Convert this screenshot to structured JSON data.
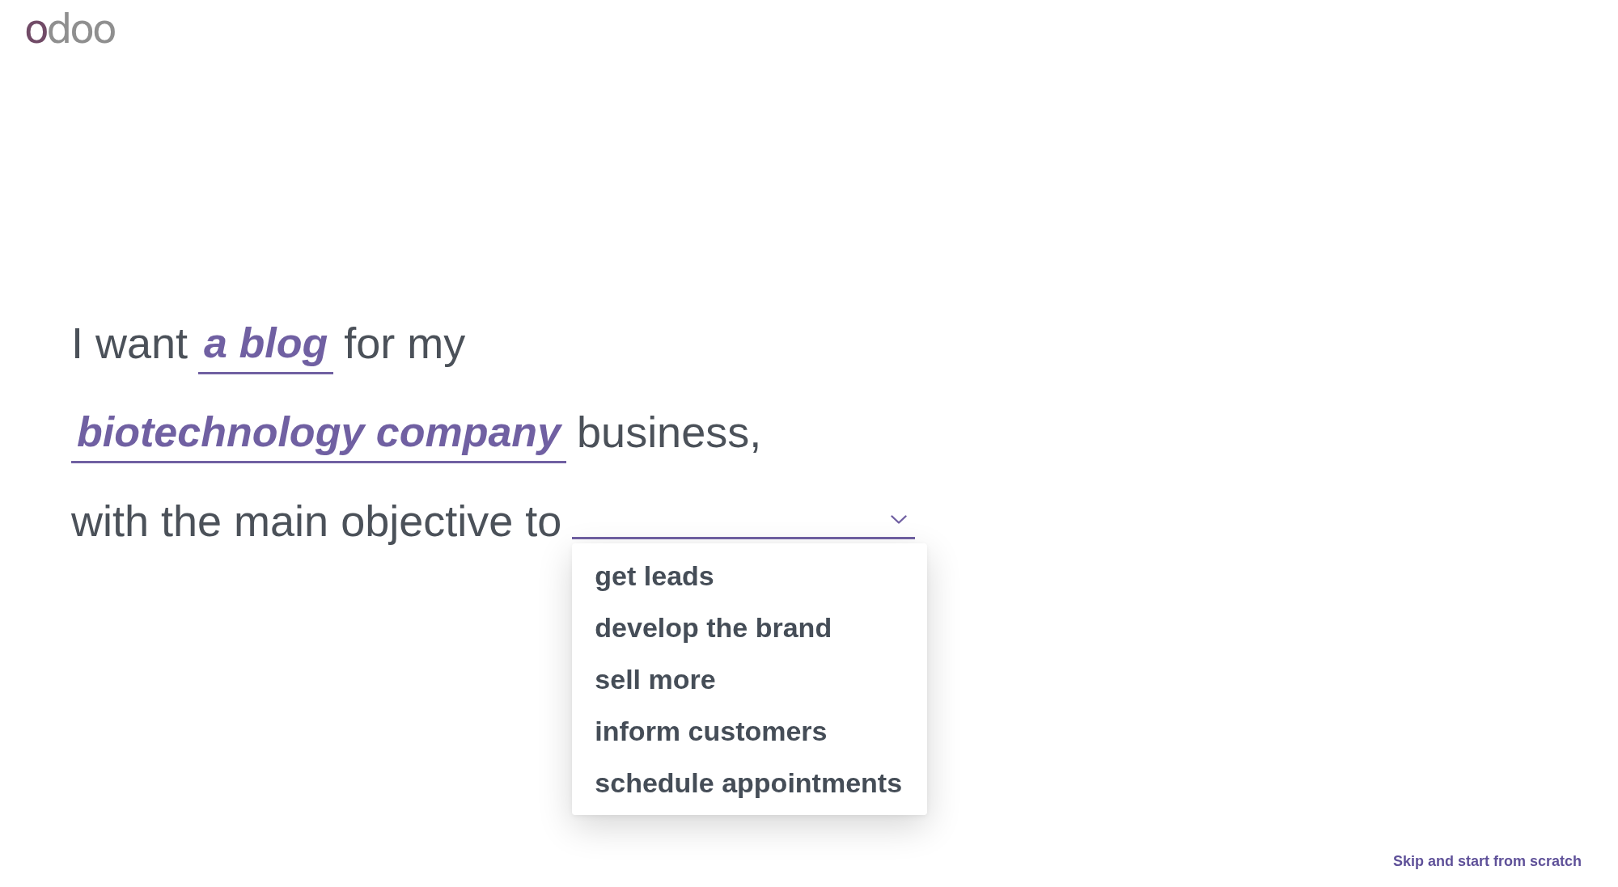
{
  "logo": {
    "text": "odoo"
  },
  "sentence": {
    "lines": [
      {
        "parts": [
          {
            "kind": "text",
            "text": "I want"
          },
          {
            "kind": "field",
            "value": "a blog"
          },
          {
            "kind": "text",
            "text": "for my"
          }
        ]
      },
      {
        "parts": [
          {
            "kind": "field",
            "value": "biotechnology company"
          },
          {
            "kind": "text",
            "text": "business,"
          }
        ]
      },
      {
        "parts": [
          {
            "kind": "text",
            "text": "with the main objective to"
          },
          {
            "kind": "select",
            "expanded": true,
            "options": [
              {
                "label": "get leads",
                "selected": false
              },
              {
                "label": "develop the brand",
                "selected": false
              },
              {
                "label": "sell more",
                "selected": false
              },
              {
                "label": "inform customers",
                "selected": false
              },
              {
                "label": "schedule appointments",
                "selected": false
              }
            ]
          }
        ]
      }
    ]
  },
  "skip_link": {
    "text": "Skip and start from scratch"
  }
}
